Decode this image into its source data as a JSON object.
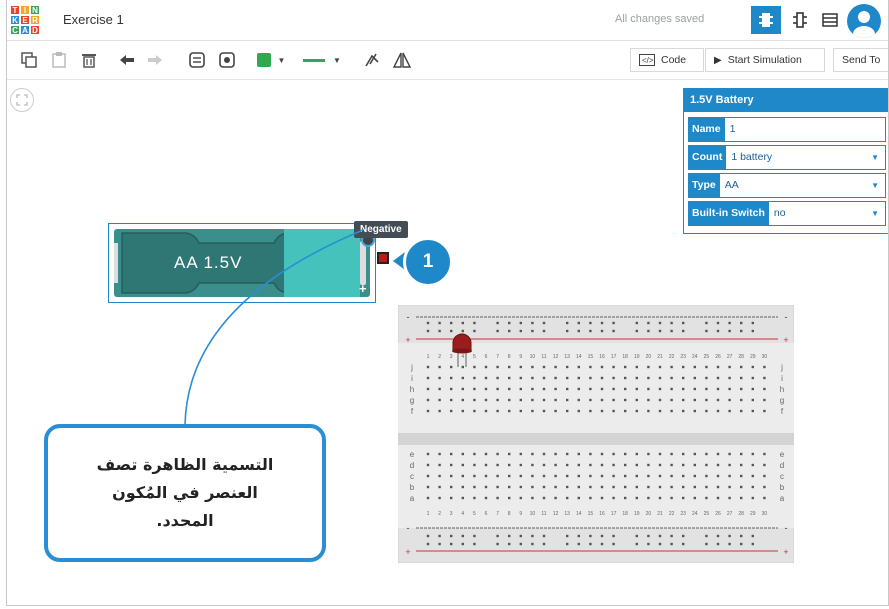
{
  "app": {
    "logo_letters": [
      "T",
      "I",
      "N",
      "K",
      "E",
      "R",
      "C",
      "A",
      "D"
    ],
    "logo_colors": [
      "#e8412c",
      "#f5a623",
      "#3ba55c",
      "#2a8ed6",
      "#e8412c",
      "#f5a623",
      "#3ba55c",
      "#2a8ed6",
      "#e8412c"
    ],
    "title": "Exercise 1",
    "save_status": "All changes saved"
  },
  "toolbar": {
    "code_label": "Code",
    "start_sim_label": "Start Simulation",
    "send_to_label": "Send To",
    "fill_color": "#2fa84f",
    "wire_color": "#2fa84f"
  },
  "component": {
    "battery_label": "AA 1.5V",
    "tooltip": "Negative"
  },
  "inspector": {
    "title": "1.5V Battery",
    "rows": [
      {
        "label": "Name",
        "value": "1",
        "dropdown": false
      },
      {
        "label": "Count",
        "value": "1 battery",
        "dropdown": true
      },
      {
        "label": "Type",
        "value": "AA",
        "dropdown": true
      },
      {
        "label": "Built-in Switch",
        "value": "no",
        "dropdown": true
      }
    ]
  },
  "annotation": {
    "badge": "1",
    "callout_lines": [
      "التسمية الظاهرة تصف",
      "العنصر في المُكون",
      "المحدد."
    ]
  },
  "breadboard": {
    "numbers": [
      "1",
      "2",
      "3",
      "4",
      "5",
      "6",
      "7",
      "8",
      "9",
      "10",
      "11",
      "12",
      "13",
      "14",
      "15",
      "16",
      "17",
      "18",
      "19",
      "20",
      "21",
      "22",
      "23",
      "24",
      "25",
      "26",
      "27",
      "28",
      "29",
      "30"
    ],
    "rows_top": [
      "j",
      "i",
      "h",
      "g",
      "f"
    ],
    "rows_bottom": [
      "e",
      "d",
      "c",
      "b",
      "a"
    ]
  },
  "colors": {
    "accent": "#1e88c8",
    "battery_body": "#3a8f8c",
    "battery_cap": "#45c2bc",
    "led": "#9b1c1c"
  }
}
